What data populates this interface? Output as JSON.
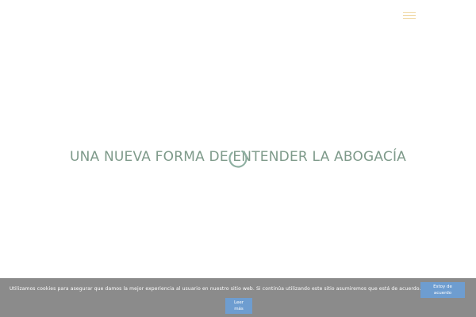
{
  "header": {
    "menu_icon": "hamburger-menu-icon",
    "menu_icon_color": "#f0d9a6"
  },
  "hero": {
    "title": "UNA NUEVA FORMA DE ENTENDER LA ABOGACÍA",
    "title_color": "#7e9a8a",
    "loader_icon": "loading-spinner-icon"
  },
  "cookie_notice": {
    "text": "Utilizamos cookies para asegurar que damos la mejor experiencia al usuario en nuestro sitio web. Si continúa utilizando este sitio asumiremos que está de acuerdo.",
    "accept_label_line1": "Estoy de",
    "accept_label_line2": "acuerdo",
    "more_label_line1": "Leer",
    "more_label_line2": "más",
    "bar_color": "#8b8b8b",
    "button_color": "#6e9dd0"
  }
}
